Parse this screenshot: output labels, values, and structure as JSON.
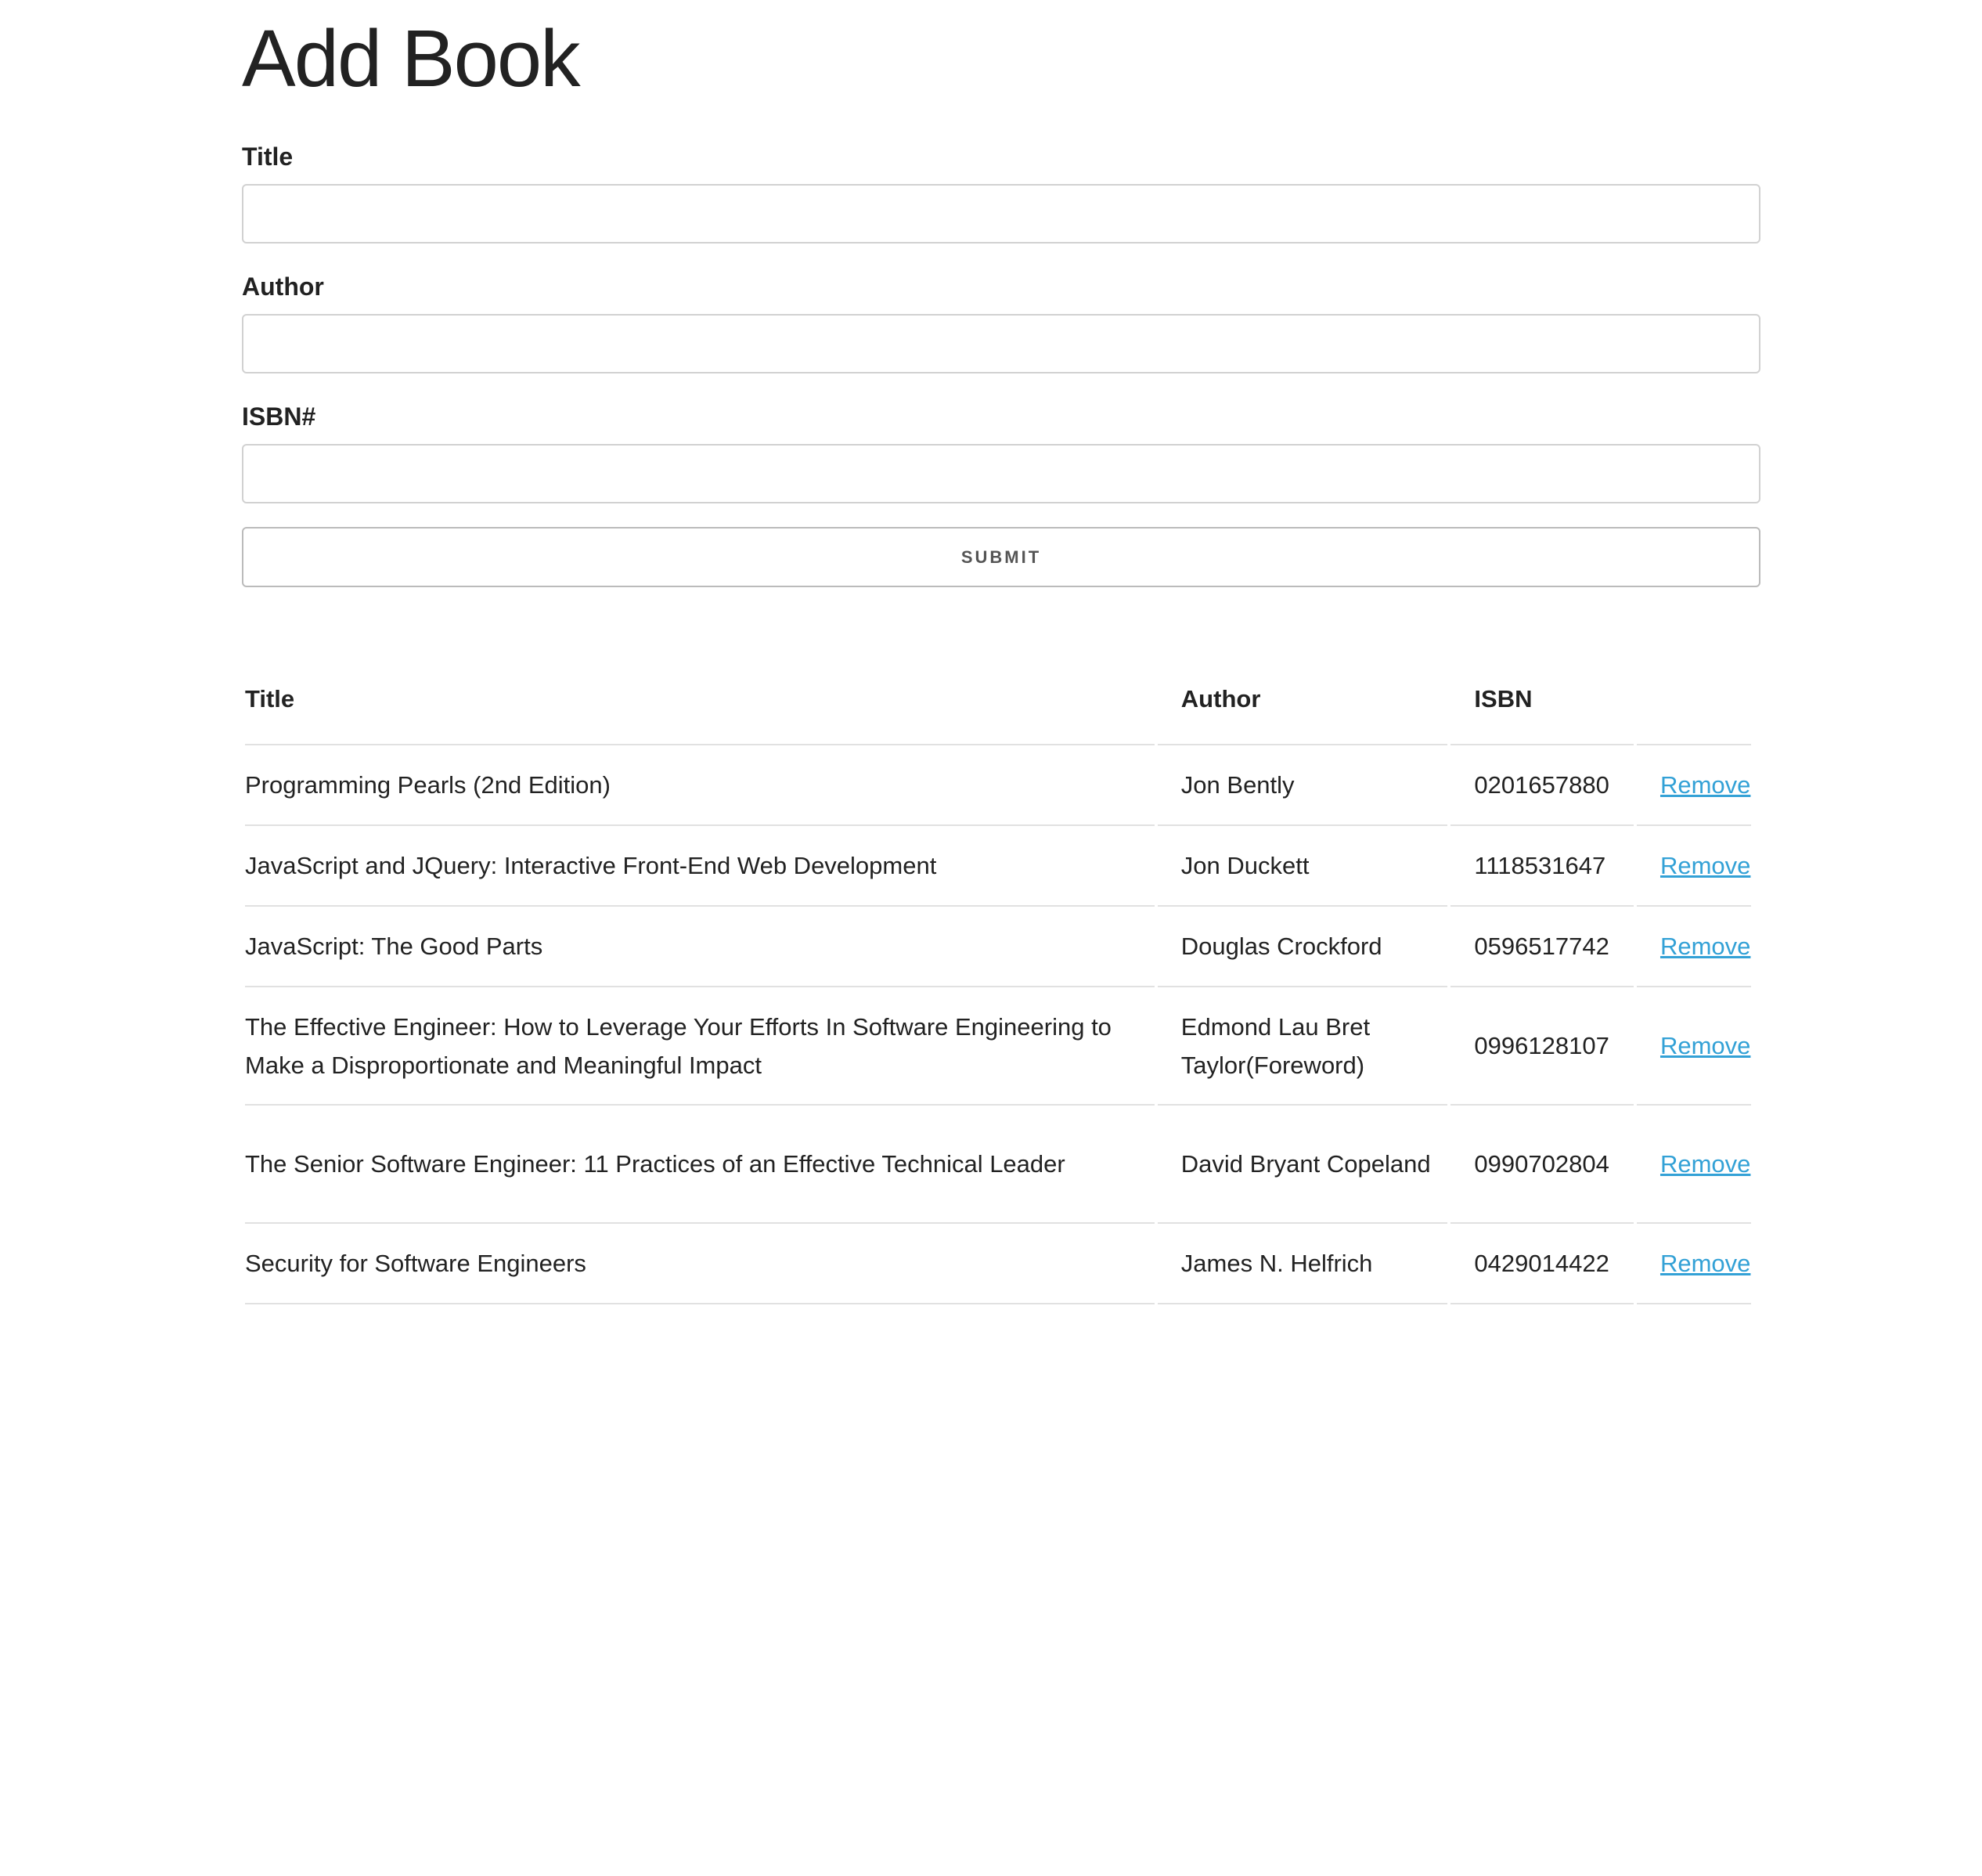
{
  "page": {
    "heading": "Add Book"
  },
  "form": {
    "title_label": "Title",
    "title_value": "",
    "author_label": "Author",
    "author_value": "",
    "isbn_label": "ISBN#",
    "isbn_value": "",
    "submit_label": "SUBMIT"
  },
  "table": {
    "headers": {
      "title": "Title",
      "author": "Author",
      "isbn": "ISBN"
    },
    "rows": [
      {
        "title": "Programming Pearls (2nd Edition)",
        "author": "Jon Bently",
        "isbn": "0201657880",
        "action": "Remove"
      },
      {
        "title": "JavaScript and JQuery: Interactive Front-End Web Development",
        "author": "Jon Duckett",
        "isbn": "1118531647",
        "action": "Remove"
      },
      {
        "title": "JavaScript: The Good Parts",
        "author": "Douglas Crockford",
        "isbn": "0596517742",
        "action": "Remove"
      },
      {
        "title": "The Effective Engineer: How to Leverage Your Efforts In Software Engineering to Make a Disproportionate and Meaningful Impact",
        "author": "Edmond Lau Bret Taylor(Foreword)",
        "isbn": "0996128107",
        "action": "Remove"
      },
      {
        "title": "The Senior Software Engineer: 11 Practices of an Effective Technical Leader",
        "author": "David Bryant Copeland",
        "isbn": "0990702804",
        "action": "Remove"
      },
      {
        "title": "Security for Software Engineers",
        "author": "James N. Helfrich",
        "isbn": "0429014422",
        "action": "Remove"
      }
    ]
  },
  "colors": {
    "text": "#222222",
    "link": "#33a1d6",
    "border": "#d1d1d1",
    "divider": "#e1e1e1"
  }
}
